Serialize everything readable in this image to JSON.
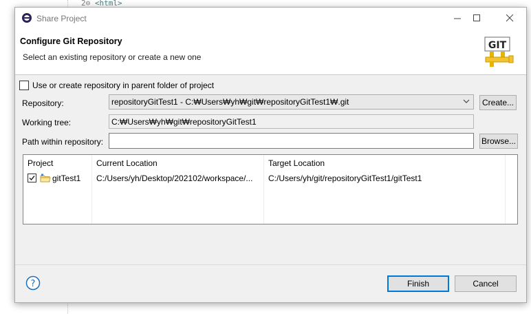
{
  "background_editor": {
    "line_number": "2",
    "code": "<html>"
  },
  "dialog": {
    "title": "Share Project",
    "header_title": "Configure Git Repository",
    "header_description": "Select an existing repository or create a new one",
    "logo_text": "GIT",
    "parent_folder_checkbox": {
      "label": "Use or create repository in parent folder of project",
      "checked": false
    },
    "repository": {
      "label": "Repository:",
      "value": "repositoryGitTest1 - C:₩Users₩yh₩git₩repositoryGitTest1₩.git",
      "create_label": "Create..."
    },
    "working_tree": {
      "label": "Working tree:",
      "value": "C:₩Users₩yh₩git₩repositoryGitTest1"
    },
    "path_within_repository": {
      "label": "Path within repository:",
      "value": "",
      "browse_label": "Browse..."
    },
    "table": {
      "columns": [
        "Project",
        "Current Location",
        "Target Location"
      ],
      "rows": [
        {
          "checked": true,
          "project": "gitTest1",
          "current_location": "C:/Users/yh/Desktop/202102/workspace/...",
          "target_location": "C:/Users/yh/git/repositoryGitTest1/gitTest1"
        }
      ]
    },
    "finish_label": "Finish",
    "cancel_label": "Cancel"
  },
  "colors": {
    "dialog_bg": "#f0f0f0",
    "default_button_border": "#0078d7",
    "help_icon": "#1a6fb8"
  }
}
